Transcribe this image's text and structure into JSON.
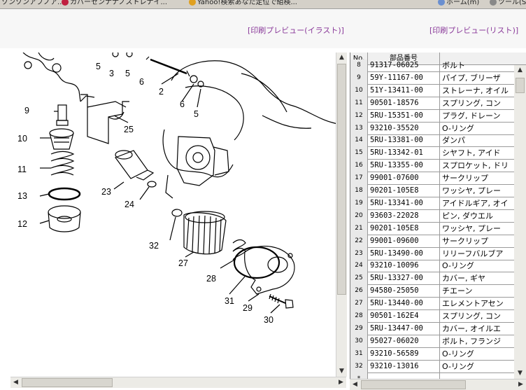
{
  "browser": {
    "tabs": [
      {
        "label": "ゾンゾンアブノア...",
        "icon_color": "#cfcfcf"
      },
      {
        "label": "カバーセンナナノストレナイ...",
        "icon_color": "#c02040"
      },
      {
        "label": "Yahoo!検索あなた定位で組検...",
        "icon_color": "#e0a020"
      },
      {
        "label": "ホーム(m)",
        "icon_color": "#6a8fd0"
      },
      {
        "label": "ツール(S)",
        "icon_color": "#888888"
      }
    ]
  },
  "toolbar": {
    "preview_illust": "[印刷プレビュー(イラスト)]",
    "preview_list": "[印刷プレビュー(リスト)]"
  },
  "illustration": {
    "labels": [
      "5",
      "3",
      "5",
      "6",
      "2",
      "6",
      "5",
      "9",
      "25",
      "10",
      "11",
      "23",
      "24",
      "13",
      "12",
      "32",
      "27",
      "28",
      "31",
      "29",
      "30"
    ]
  },
  "table": {
    "headers": {
      "no": "No.",
      "part_number": "部品番号",
      "name": ""
    },
    "rows": [
      {
        "no": "8",
        "part": "91317-06025",
        "name": "ボルト"
      },
      {
        "no": "9",
        "part": "59Y-11167-00",
        "name": "パイプ, ブリーザ"
      },
      {
        "no": "10",
        "part": "51Y-13411-00",
        "name": "ストレーナ, オイル"
      },
      {
        "no": "11",
        "part": "90501-18576",
        "name": "スプリング, コン"
      },
      {
        "no": "12",
        "part": "5RU-15351-00",
        "name": "プラグ, ドレーン"
      },
      {
        "no": "13",
        "part": "93210-35520",
        "name": "O-リング"
      },
      {
        "no": "14",
        "part": "5RU-13381-00",
        "name": "ダンパ"
      },
      {
        "no": "15",
        "part": "5RU-13342-01",
        "name": "シヤフト, アイド"
      },
      {
        "no": "16",
        "part": "5RU-13355-00",
        "name": "スプロケット, ドリ"
      },
      {
        "no": "17",
        "part": "99001-07600",
        "name": "サークリップ"
      },
      {
        "no": "18",
        "part": "90201-105E8",
        "name": "ワッシヤ, プレー"
      },
      {
        "no": "19",
        "part": "5RU-13341-00",
        "name": "アイドルギア, オイ"
      },
      {
        "no": "20",
        "part": "93603-22028",
        "name": "ピン, ダウエル"
      },
      {
        "no": "21",
        "part": "90201-105E8",
        "name": "ワッシヤ, プレー"
      },
      {
        "no": "22",
        "part": "99001-09600",
        "name": "サークリップ"
      },
      {
        "no": "23",
        "part": "5RU-13490-00",
        "name": "リリーフバルブア"
      },
      {
        "no": "24",
        "part": "93210-10096",
        "name": "O-リング"
      },
      {
        "no": "25",
        "part": "5RU-13327-00",
        "name": "カバー, ギヤ"
      },
      {
        "no": "26",
        "part": "94580-25050",
        "name": "チエーン"
      },
      {
        "no": "27",
        "part": "5RU-13440-00",
        "name": "エレメントアセン"
      },
      {
        "no": "28",
        "part": "90501-162E4",
        "name": "スプリング, コン"
      },
      {
        "no": "29",
        "part": "5RU-13447-00",
        "name": "カバー, オイルエ"
      },
      {
        "no": "30",
        "part": "95027-06020",
        "name": "ボルト, フランジ"
      },
      {
        "no": "31",
        "part": "93210-56589",
        "name": "O-リング"
      },
      {
        "no": "32",
        "part": "93210-13016",
        "name": "O-リング"
      },
      {
        "no": "*",
        "part": "",
        "name": ""
      }
    ]
  }
}
